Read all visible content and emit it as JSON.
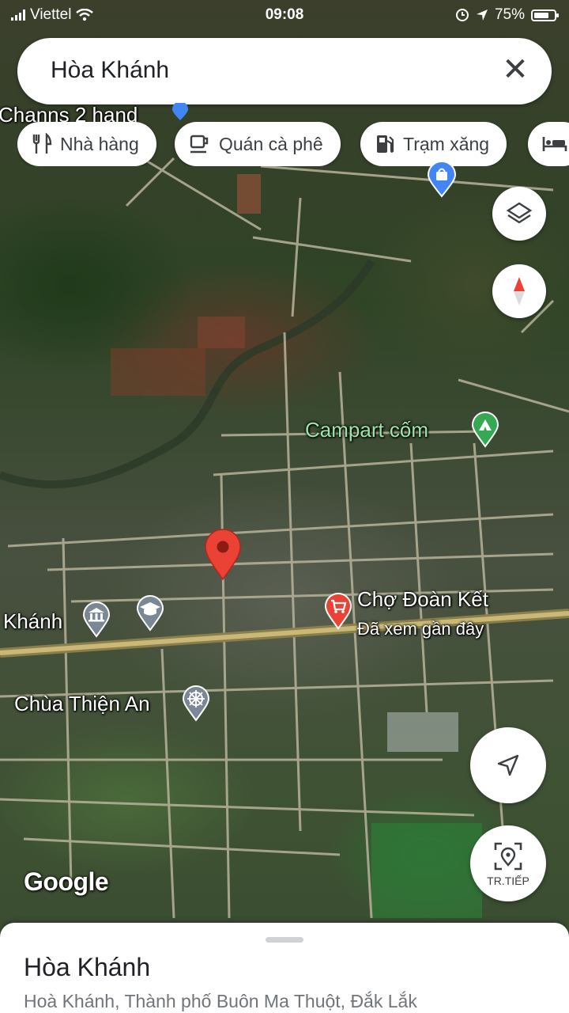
{
  "status_bar": {
    "carrier": "Viettel",
    "time": "09:08",
    "battery": "75%",
    "battery_level": 0.75
  },
  "search": {
    "query": "Hòa Khánh",
    "clear_icon": "close-icon"
  },
  "chips": [
    {
      "label": "Nhà hàng",
      "icon": "restaurant-icon"
    },
    {
      "label": "Quán cà phê",
      "icon": "coffee-icon"
    },
    {
      "label": "Trạm xăng",
      "icon": "gas-station-icon"
    },
    {
      "label": "",
      "icon": "hotel-icon"
    }
  ],
  "map_labels": {
    "shop_top": "Channs 2 hand",
    "camp": "Campart cốm",
    "market": "Chợ Đoàn Kết",
    "market_sub": "Đã xem gần đây",
    "khanh": "Khánh",
    "pagoda": "Chùa Thiện An"
  },
  "buttons": {
    "layers_icon": "layers-icon",
    "compass_icon": "compass-icon",
    "navigate_icon": "navigation-arrow-icon",
    "next_label": "TR.TIẾP"
  },
  "watermark": "Google",
  "place": {
    "name": "Hòa Khánh",
    "address": "Hoà Khánh, Thành phố Buôn Ma Thuột, Đắk Lắk"
  },
  "colors": {
    "pin_red": "#ea4335",
    "camp_green": "#34a853",
    "road": "#b8b39a",
    "highway": "#c9b878"
  }
}
